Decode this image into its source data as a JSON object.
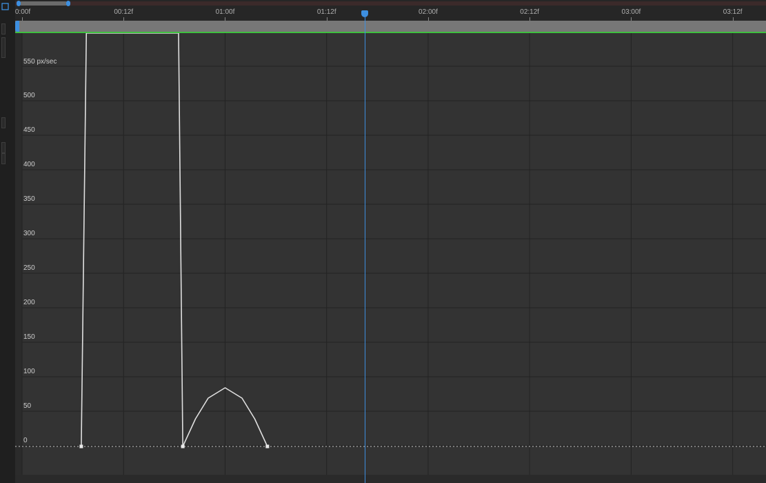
{
  "timeline": {
    "ticks": [
      {
        "label": "0:00f",
        "frame": 0
      },
      {
        "label": "00:12f",
        "frame": 12
      },
      {
        "label": "01:00f",
        "frame": 24
      },
      {
        "label": "01:12f",
        "frame": 36
      },
      {
        "label": "02:00f",
        "frame": 48
      },
      {
        "label": "02:12f",
        "frame": 60
      },
      {
        "label": "03:00f",
        "frame": 72
      },
      {
        "label": "03:12f",
        "frame": 84
      }
    ],
    "current_time_frame": 40.5
  },
  "graph": {
    "y_unit_label": "550 px/sec",
    "y_ticks": [
      "500",
      "450",
      "400",
      "350",
      "300",
      "250",
      "200",
      "150",
      "100",
      "50",
      "0"
    ],
    "y_tick_values": [
      500,
      450,
      400,
      350,
      300,
      250,
      200,
      150,
      100,
      50,
      0
    ],
    "y_max": 550,
    "keyframes": [
      {
        "frame": 7.0,
        "value": 0
      },
      {
        "frame": 19.0,
        "value": 0
      },
      {
        "frame": 29.0,
        "value": 0
      }
    ],
    "curve_points": [
      {
        "frame": 7.0,
        "value": 0
      },
      {
        "frame": 7.6,
        "value": 600
      },
      {
        "frame": 18.5,
        "value": 600
      },
      {
        "frame": 19.0,
        "value": 0
      },
      {
        "frame": 20.5,
        "value": 40
      },
      {
        "frame": 22.0,
        "value": 70
      },
      {
        "frame": 24.0,
        "value": 85
      },
      {
        "frame": 26.0,
        "value": 70
      },
      {
        "frame": 27.5,
        "value": 40
      },
      {
        "frame": 29.0,
        "value": 0
      }
    ],
    "colors": {
      "curve": "#e0e0e0",
      "grid": "#232323",
      "cti": "#3d8fe0",
      "work_area": "#3fbf3f",
      "baseline": "#c8c8c8"
    }
  }
}
